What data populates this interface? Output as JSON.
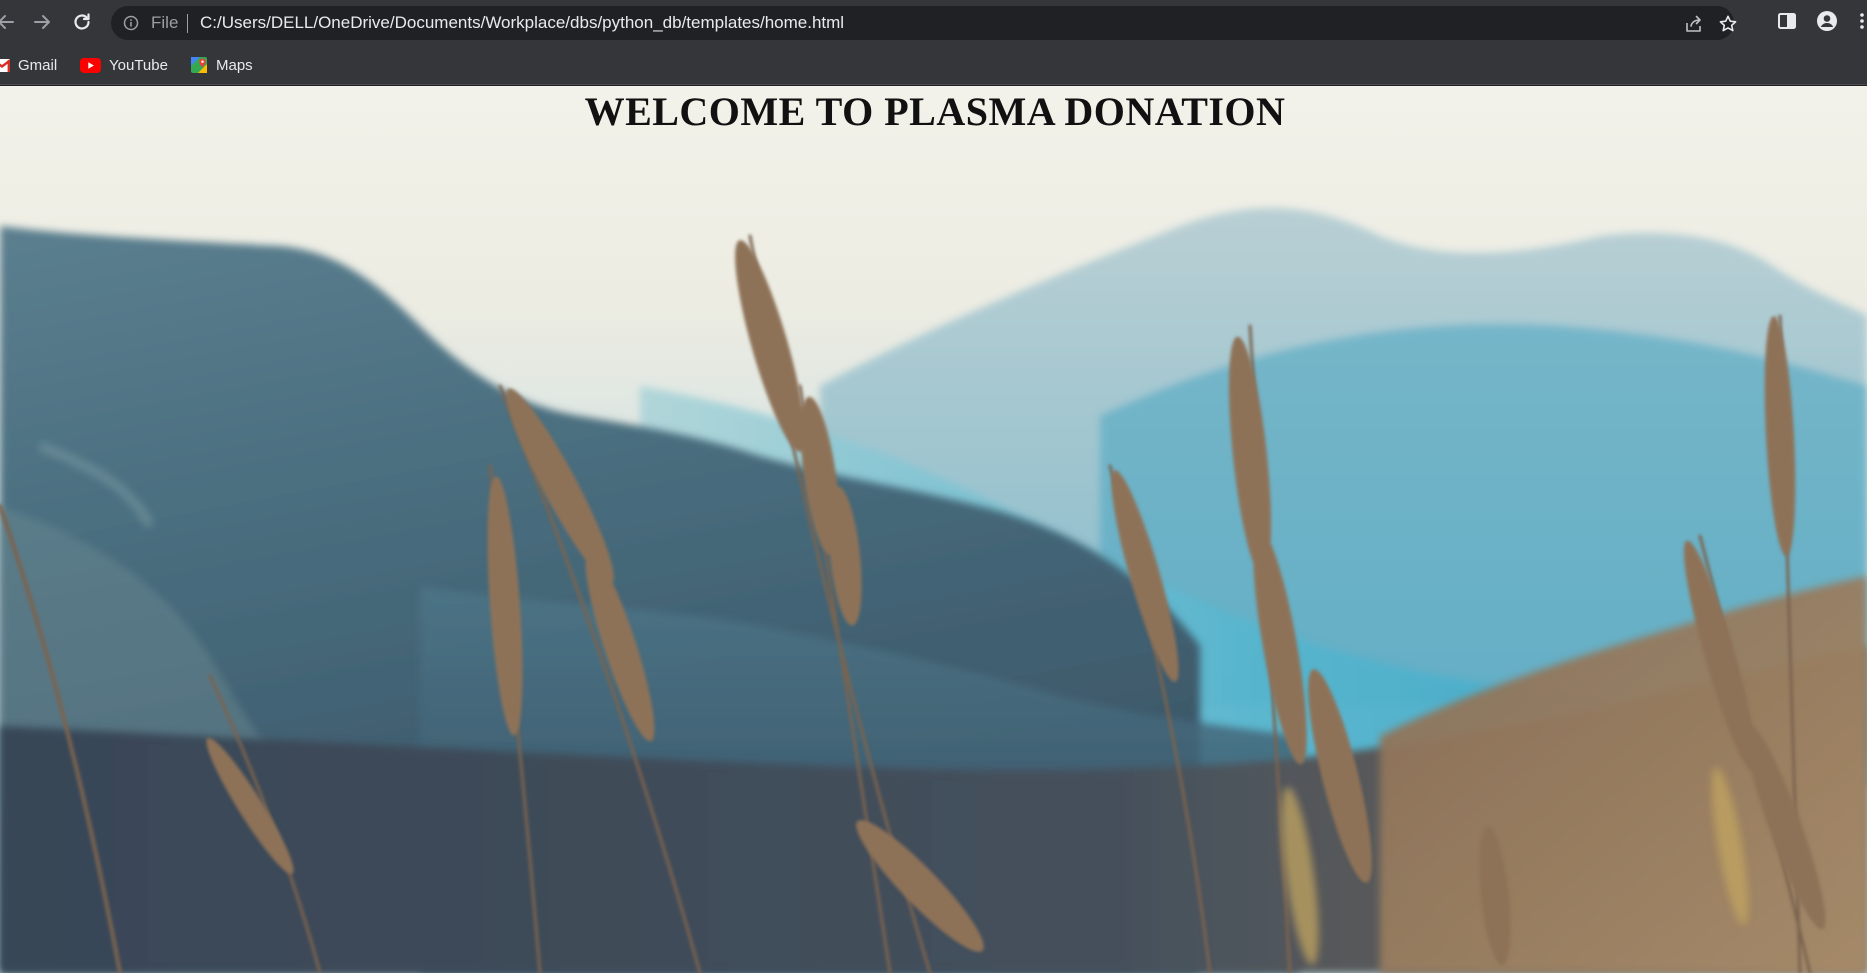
{
  "browser": {
    "omnibox": {
      "scheme_label": "File",
      "url": "C:/Users/DELL/OneDrive/Documents/Workplace/dbs/python_db/templates/home.html"
    },
    "bookmarks": [
      {
        "label": "Gmail",
        "icon": "gmail-icon"
      },
      {
        "label": "YouTube",
        "icon": "youtube-icon"
      },
      {
        "label": "Maps",
        "icon": "maps-icon"
      }
    ],
    "colors": {
      "toolbar_bg": "#35363a",
      "omnibox_bg": "#202124",
      "text": "#e8eaed"
    }
  },
  "page": {
    "title": "WELCOME TO PLASMA DONATION"
  }
}
